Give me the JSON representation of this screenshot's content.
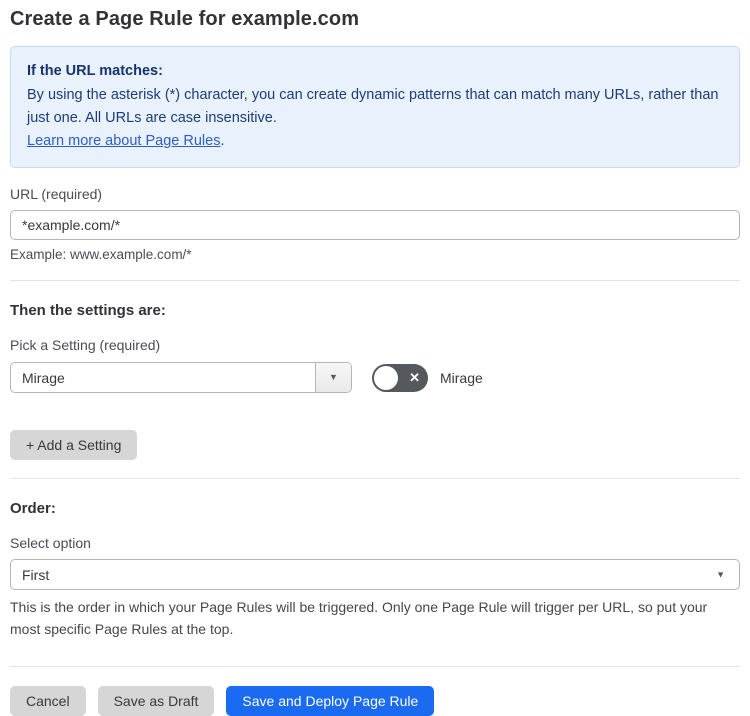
{
  "page": {
    "title": "Create a Page Rule for example.com"
  },
  "info_box": {
    "heading": "If the URL matches:",
    "body": "By using the asterisk (*) character, you can create dynamic patterns that can match many URLs, rather than just one. All URLs are case insensitive.",
    "link_label": "Learn more about Page Rules",
    "link_suffix": "."
  },
  "url_field": {
    "label": "URL (required)",
    "value": "*example.com/*",
    "helper": "Example: www.example.com/*"
  },
  "settings_section": {
    "heading": "Then the settings are:",
    "picker_label": "Pick a Setting (required)",
    "picker_value": "Mirage",
    "toggle_label": "Mirage",
    "toggle_state": "off",
    "add_setting_label": "+ Add a Setting"
  },
  "order_section": {
    "heading": "Order:",
    "select_label": "Select option",
    "select_value": "First",
    "helper": "This is the order in which your Page Rules will be triggered. Only one Page Rule will trigger per URL, so put your most specific Page Rules at the top."
  },
  "footer": {
    "cancel_label": "Cancel",
    "save_draft_label": "Save as Draft",
    "save_deploy_label": "Save and Deploy Page Rule"
  },
  "icons": {
    "caret_down": "▼",
    "toggle_x": "✕"
  },
  "colors": {
    "primary_blue": "#1a6af2",
    "info_background": "#e9f2fc",
    "info_border": "#c3dbf4",
    "info_text": "#1b3c78",
    "link_blue": "#2c5dc9",
    "toggle_off": "#55585d",
    "button_grey": "#d6d6d6",
    "text_dark": "#36393e",
    "label_grey": "#4a4d52"
  }
}
